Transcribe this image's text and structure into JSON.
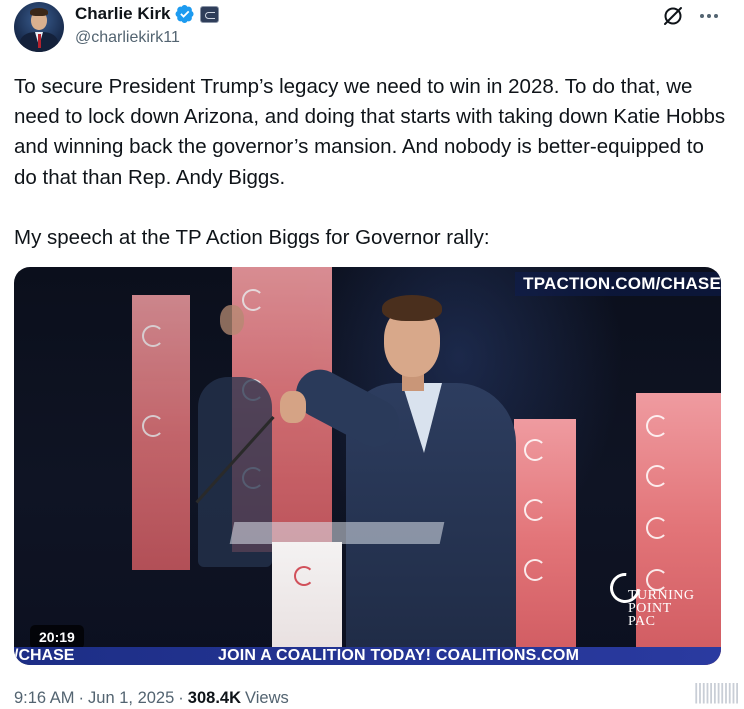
{
  "author": {
    "display_name": "Charlie Kirk",
    "handle": "@charliekirk11",
    "verified_color": "#1d9bf0"
  },
  "header_icons": [
    "grok-icon",
    "more-icon"
  ],
  "tweet": {
    "paragraph1": "To secure President Trump’s legacy we need to win in 2028. To do that, we need to lock down Arizona, and doing that starts with taking down Katie Hobbs and winning back the governor’s mansion. And nobody is better-equipped to do that than Rep. Andy Biggs.",
    "paragraph2": "My speech at the TP Action Biggs for Governor rally:"
  },
  "video": {
    "duration": "20:19",
    "overlay_url": "TPACTION.COM/CHASE",
    "ticker_left": "/CHASE",
    "ticker_main": "JOIN A COALITION TODAY! COALITIONS.COM",
    "logo_text_line1": "TURNING",
    "logo_text_line2": "POINT PAC"
  },
  "meta": {
    "time": "9:16 AM",
    "date": "Jun 1, 2025",
    "views_count": "308.4K",
    "views_label": "Views",
    "separator": "·"
  },
  "watermark": "||||||||||||"
}
